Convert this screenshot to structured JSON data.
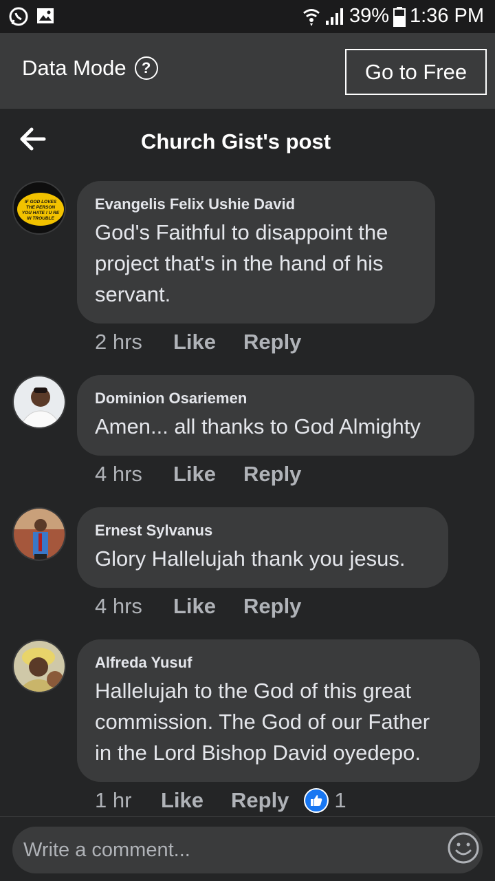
{
  "status_bar": {
    "battery": "39%",
    "time": "1:36 PM"
  },
  "data_mode": {
    "label": "Data Mode",
    "button": "Go to Free"
  },
  "header": {
    "title": "Church Gist's post"
  },
  "comments": [
    {
      "author": "Evangelis Felix Ushie David",
      "lines": [
        "God's Faithful to disappoint the",
        "project that's in the hand of his",
        "servant."
      ],
      "time": "2 hrs",
      "like": "Like",
      "reply": "Reply",
      "avatar_text": [
        "IF GOD LOVES",
        "THE PERSON",
        "YOU HATE ! U RE",
        "IN TROUBLE"
      ]
    },
    {
      "author": "Dominion Osariemen",
      "lines": [
        "Amen... all thanks to God Almighty"
      ],
      "time": "4 hrs",
      "like": "Like",
      "reply": "Reply"
    },
    {
      "author": "Ernest Sylvanus",
      "lines": [
        "Glory Hallelujah thank you jesus."
      ],
      "time": "4 hrs",
      "like": "Like",
      "reply": "Reply"
    },
    {
      "author": "Alfreda Yusuf",
      "lines": [
        "Hallelujah to the God of this great",
        "commission. The God of our Father",
        "in the Lord Bishop David oyedepo."
      ],
      "time": "1 hr",
      "like": "Like",
      "reply": "Reply",
      "reaction_count": "1"
    }
  ],
  "composer": {
    "placeholder": "Write a comment..."
  },
  "colors": {
    "background": "#242526",
    "bubble": "#3a3b3c",
    "accent": "#1877f2"
  }
}
